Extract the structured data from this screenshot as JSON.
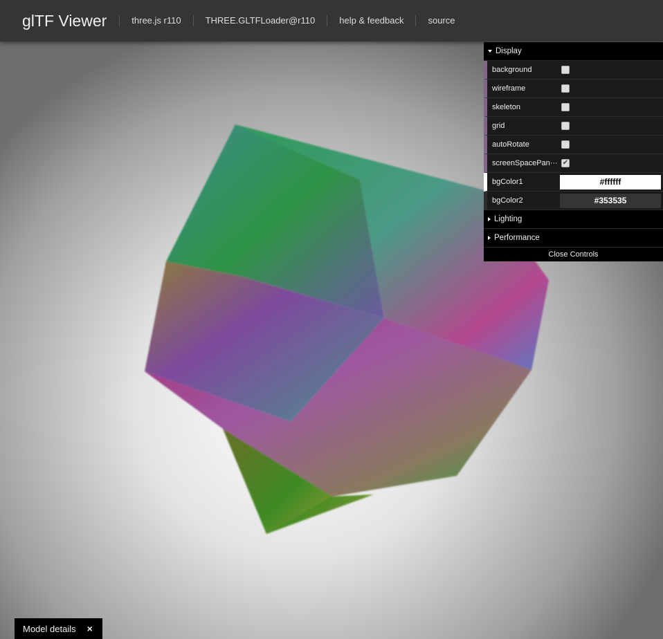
{
  "header": {
    "title": "glTF Viewer",
    "links": [
      "three.js r110",
      "THREE.GLTFLoader@r110",
      "help & feedback",
      "source"
    ]
  },
  "gui": {
    "display": {
      "title": "Display",
      "toggles": [
        {
          "label": "background",
          "checked": false
        },
        {
          "label": "wireframe",
          "checked": false
        },
        {
          "label": "skeleton",
          "checked": false
        },
        {
          "label": "grid",
          "checked": false
        },
        {
          "label": "autoRotate",
          "checked": false
        },
        {
          "label": "screenSpacePan···",
          "checked": true
        }
      ],
      "bgColor1": {
        "label": "bgColor1",
        "value": "#ffffff"
      },
      "bgColor2": {
        "label": "bgColor2",
        "value": "#353535"
      }
    },
    "lighting": "Lighting",
    "performance": "Performance",
    "close": "Close Controls",
    "check_glyph": "✔"
  },
  "details": {
    "label": "Model details",
    "close": "×"
  }
}
